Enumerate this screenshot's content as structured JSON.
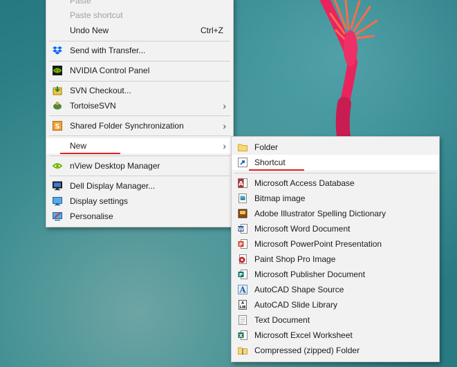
{
  "context_menu": {
    "paste_label": "Paste",
    "paste_shortcut_label": "Paste shortcut",
    "undo_label": "Undo New",
    "undo_shortcut": "Ctrl+Z",
    "send_transfer_label": "Send with Transfer...",
    "nvidia_label": "NVIDIA Control Panel",
    "svn_checkout_label": "SVN Checkout...",
    "tortoisesvn_label": "TortoiseSVN",
    "shared_folder_label": "Shared Folder Synchronization",
    "new_label": "New",
    "nview_label": "nView Desktop Manager",
    "dell_display_label": "Dell Display Manager...",
    "display_settings_label": "Display settings",
    "personalise_label": "Personalise"
  },
  "new_submenu": {
    "items": [
      {
        "label": "Folder",
        "icon": "folder-icon"
      },
      {
        "label": "Shortcut",
        "icon": "shortcut-icon"
      },
      {
        "label": "Microsoft Access Database",
        "icon": "access-icon"
      },
      {
        "label": "Bitmap image",
        "icon": "bitmap-icon"
      },
      {
        "label": "Adobe Illustrator Spelling Dictionary",
        "icon": "illustrator-dictionary-icon"
      },
      {
        "label": "Microsoft Word Document",
        "icon": "word-icon"
      },
      {
        "label": "Microsoft PowerPoint Presentation",
        "icon": "powerpoint-icon"
      },
      {
        "label": "Paint Shop Pro Image",
        "icon": "paintshop-icon"
      },
      {
        "label": "Microsoft Publisher Document",
        "icon": "publisher-icon"
      },
      {
        "label": "AutoCAD Shape Source",
        "icon": "autocad-shape-icon"
      },
      {
        "label": "AutoCAD Slide Library",
        "icon": "autocad-slide-icon"
      },
      {
        "label": "Text Document",
        "icon": "text-document-icon"
      },
      {
        "label": "Microsoft Excel Worksheet",
        "icon": "excel-icon"
      },
      {
        "label": "Compressed (zipped) Folder",
        "icon": "zip-folder-icon"
      }
    ]
  },
  "colors": {
    "menu_bg": "#f2f2f2",
    "highlight": "#ffffff",
    "annotation_red": "#e02020",
    "wallpaper_teal": "#2c7f86",
    "flower_pink": "#e8245e"
  }
}
